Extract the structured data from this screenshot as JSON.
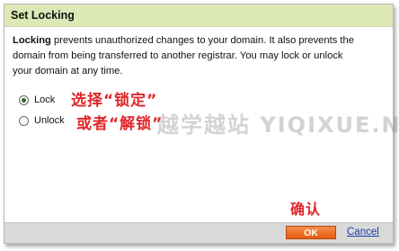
{
  "dialog": {
    "title": "Set Locking",
    "description_bold": "Locking",
    "description_line1_rest": " prevents unauthorized changes to your domain. It also prevents the",
    "description_line2": "domain from being transferred to another registrar. You may lock or  unlock",
    "description_line3": "your domain at any time."
  },
  "options": [
    {
      "label": "Lock",
      "selected": true
    },
    {
      "label": "Unlock",
      "selected": false
    }
  ],
  "footer": {
    "ok_label": "OK",
    "cancel_label": "Cancel"
  },
  "annotations": {
    "select_line1": "选择“锁定”",
    "select_line2": "或者“解锁”",
    "confirm": "确认"
  },
  "watermark": "越学越站 YIQIXUE.NET",
  "colors": {
    "title_bar": "#dce8b6",
    "ok_button": "#ee6b22",
    "annotation": "#e0262a",
    "link": "#1a3fa8"
  }
}
